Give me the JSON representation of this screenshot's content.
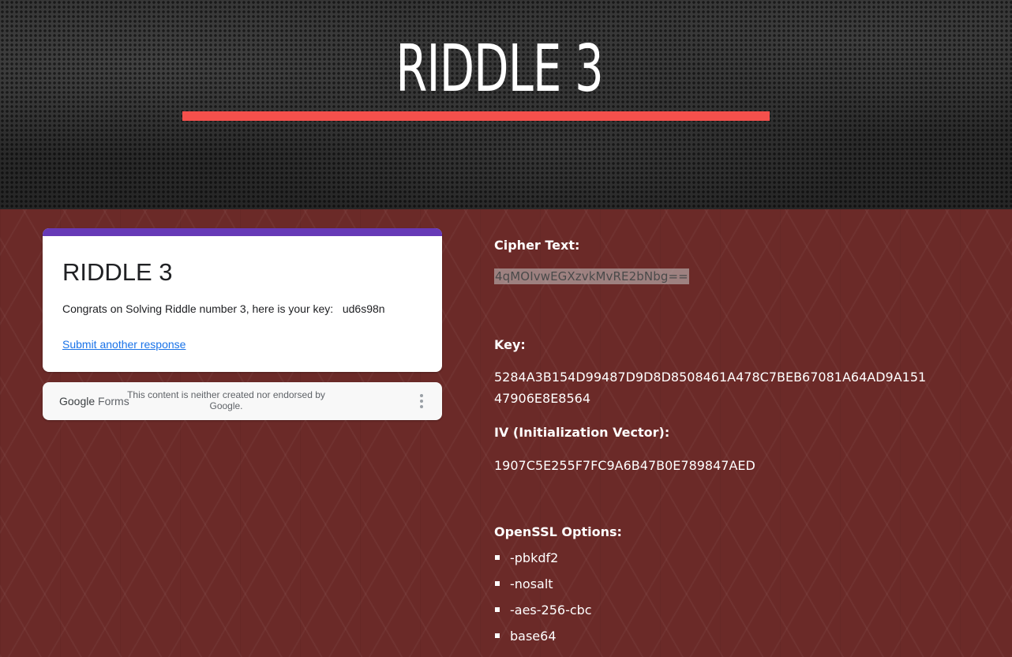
{
  "header": {
    "title": "RIDDLE 3",
    "rule_color": "#f4504c"
  },
  "form": {
    "accent_color": "#673ab7",
    "title": "RIDDLE 3",
    "message": "Congrats on Solving Riddle number 3, here is your key:   ud6s98n",
    "submit_another_label": "Submit another response",
    "footer": {
      "logo_google": "Google",
      "logo_forms": "Forms",
      "disclaimer": "This content is neither created nor endorsed by Google.",
      "menu_icon": "more-vert-icon"
    }
  },
  "info": {
    "cipher_label": "Cipher Text:",
    "cipher_value": "4qMOIvwEGXzvkMvRE2bNbg==",
    "key_label": "Key:",
    "key_value_line1": "5284A3B154D99487D9D8D8508461A478C7BEB67081A64AD9A151",
    "key_value_line2": "47906E8E8564",
    "iv_label": "IV (Initialization Vector):",
    "iv_value": "1907C5E255F7FC9A6B47B0E789847AED",
    "openssl_label": "OpenSSL Options:",
    "options": [
      "-pbkdf2",
      "-nosalt",
      "-aes-256-cbc",
      "base64"
    ]
  }
}
